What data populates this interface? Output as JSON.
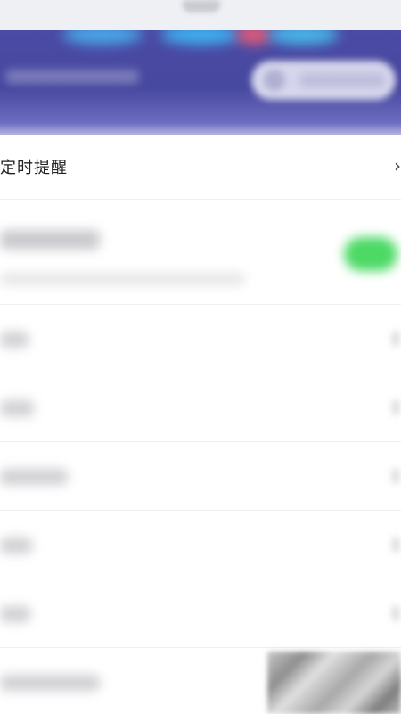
{
  "banner": {
    "accent_color": "#4b4aa5"
  },
  "settings": {
    "scheduled_reminder_label": "定时提醒",
    "chevron": "›"
  },
  "toggle": {
    "color": "#4cd964",
    "state": "on"
  }
}
